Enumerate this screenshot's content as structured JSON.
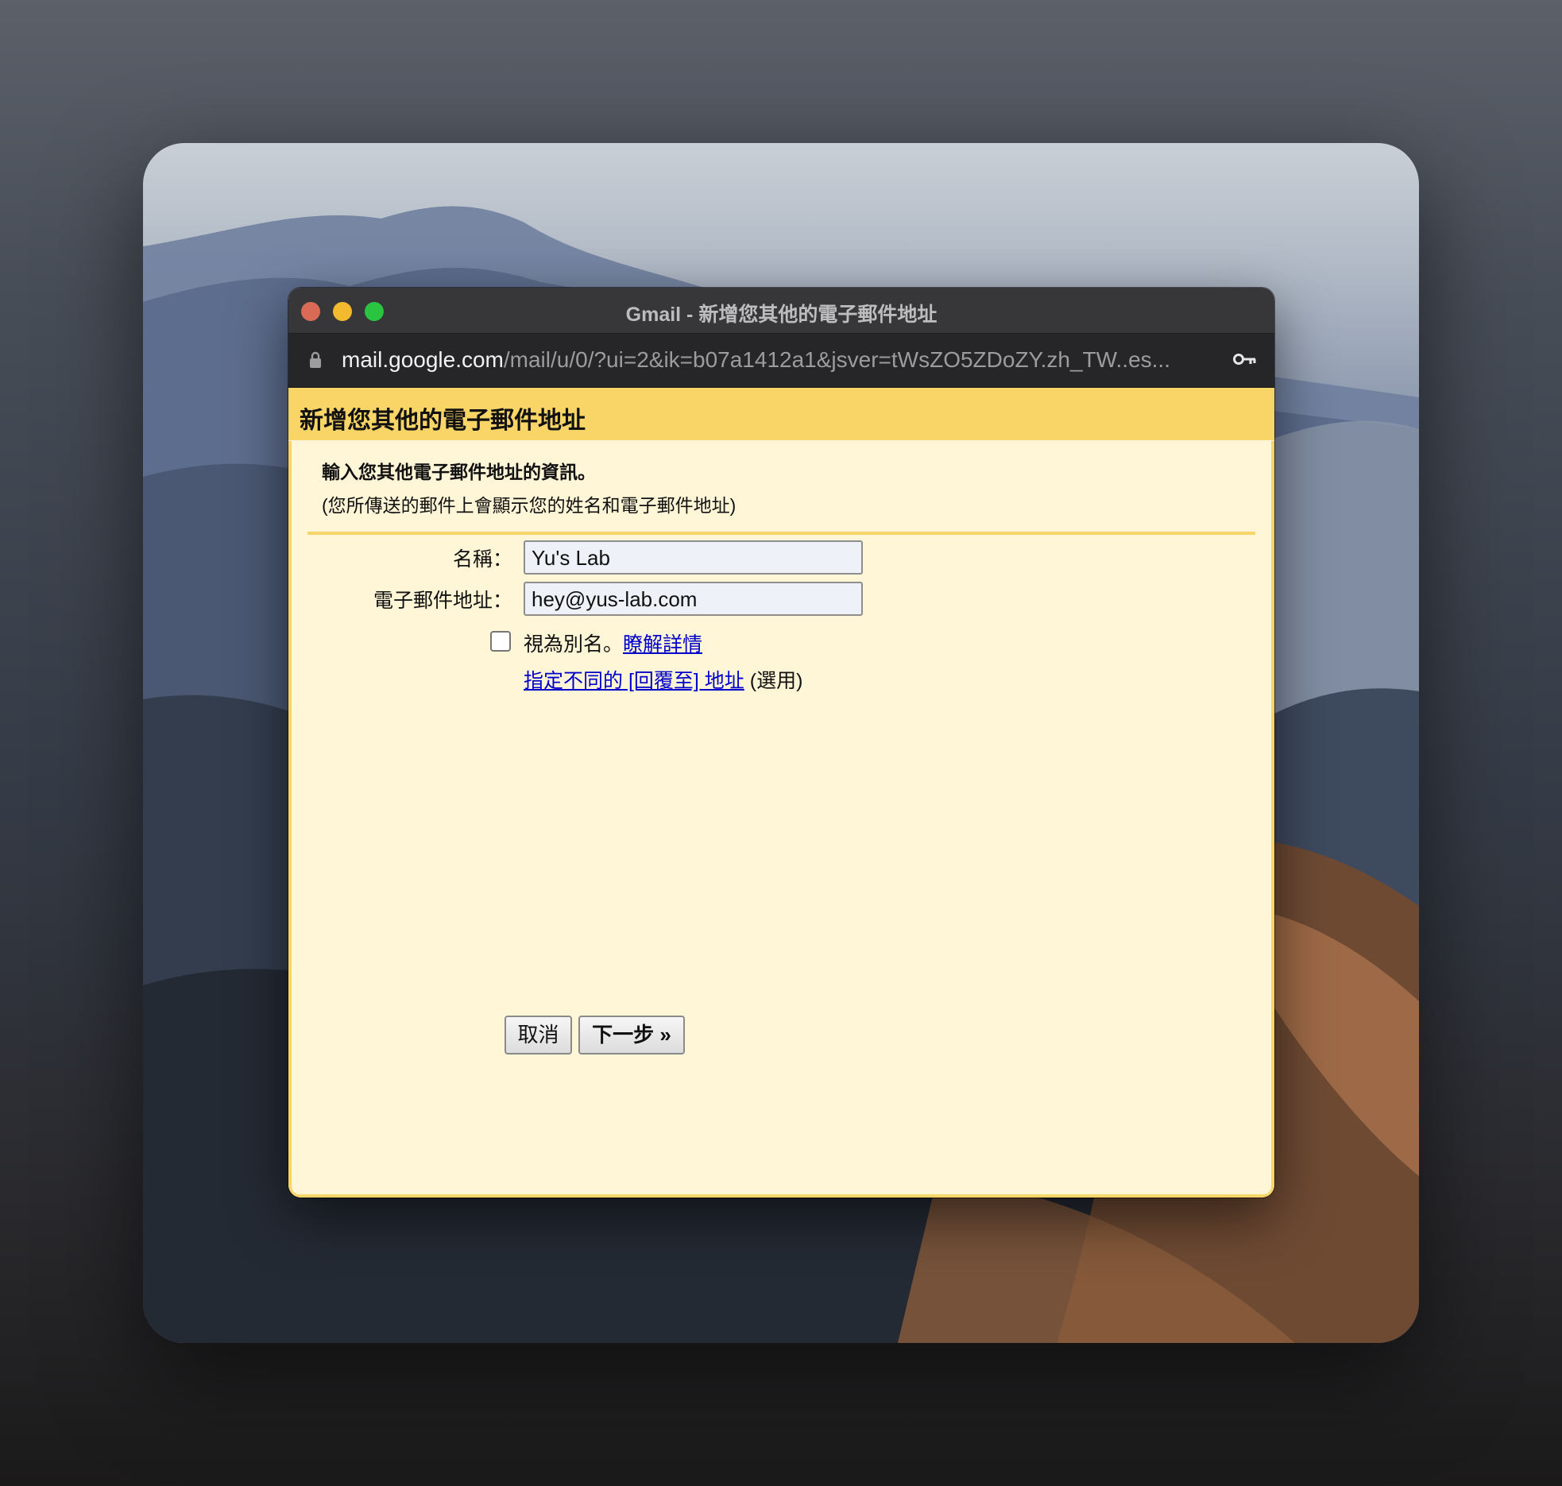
{
  "window": {
    "title": "Gmail - 新增您其他的電子郵件地址",
    "url_host": "mail.google.com",
    "url_path": "/mail/u/0/?ui=2&ik=b07a1412a1&jsver=tWsZO5ZDoZY.zh_TW..es..."
  },
  "page": {
    "header": "新增您其他的電子郵件地址",
    "intro_title": "輸入您其他電子郵件地址的資訊。",
    "intro_sub": "(您所傳送的郵件上會顯示您的姓名和電子郵件地址)"
  },
  "form": {
    "name_label": "名稱：",
    "name_value": "Yu's Lab",
    "email_label": "電子郵件地址：",
    "email_value": "hey@yus-lab.com",
    "alias_checked": false,
    "alias_text": "視為別名。",
    "alias_learn_more": "瞭解詳情",
    "reply_to_link": "指定不同的 [回覆至] 地址",
    "reply_to_optional": "(選用)"
  },
  "buttons": {
    "cancel": "取消",
    "next": "下一步 »"
  },
  "icons": {
    "lock": "lock-icon",
    "key": "key-icon"
  },
  "colors": {
    "header_yellow": "#f9d567",
    "content_bg": "#fff6d7",
    "link_blue": "#0000cc",
    "titlebar": "#37373a",
    "close": "#d86a56",
    "minimize": "#f3ba2f",
    "maximize": "#2ac441"
  }
}
